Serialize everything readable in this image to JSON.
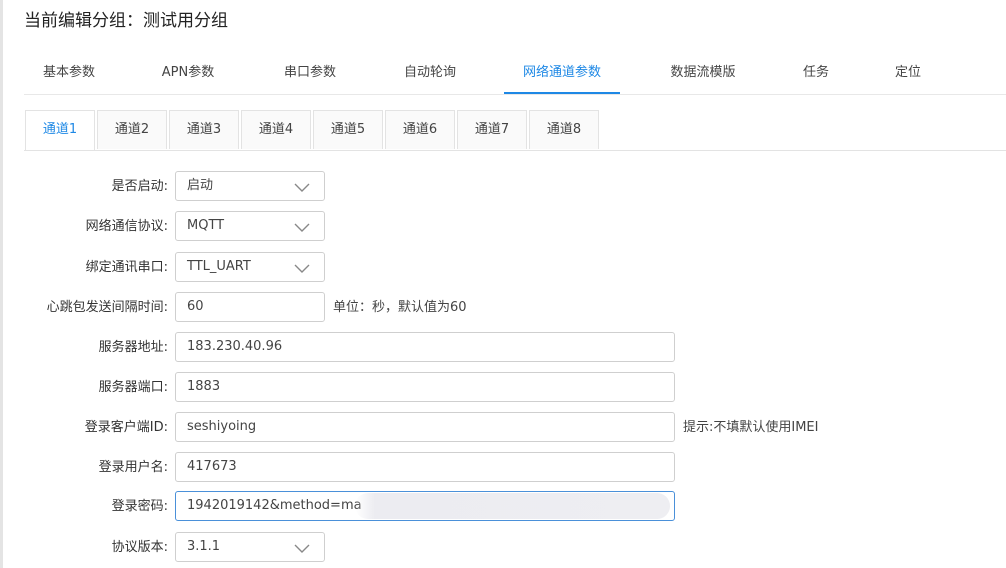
{
  "page": {
    "title": "当前编辑分组：测试用分组"
  },
  "main_tabs": [
    {
      "label": "基本参数"
    },
    {
      "label": "APN参数"
    },
    {
      "label": "串口参数"
    },
    {
      "label": "自动轮询"
    },
    {
      "label": "网络通道参数",
      "active": true
    },
    {
      "label": "数据流模版"
    },
    {
      "label": "任务"
    },
    {
      "label": "定位"
    }
  ],
  "sub_tabs": [
    {
      "label": "通道1",
      "active": true
    },
    {
      "label": "通道2"
    },
    {
      "label": "通道3"
    },
    {
      "label": "通道4"
    },
    {
      "label": "通道5"
    },
    {
      "label": "通道6"
    },
    {
      "label": "通道7"
    },
    {
      "label": "通道8"
    }
  ],
  "form": {
    "enabled": {
      "label": "是否启动:",
      "value": "启动"
    },
    "protocol": {
      "label": "网络通信协议:",
      "value": "MQTT"
    },
    "serial": {
      "label": "绑定通讯串口:",
      "value": "TTL_UART"
    },
    "heartbeat": {
      "label": "心跳包发送间隔时间:",
      "value": "60",
      "hint": "单位：秒，默认值为60"
    },
    "server_address": {
      "label": "服务器地址:",
      "value": "183.230.40.96"
    },
    "server_port": {
      "label": "服务器端口:",
      "value": "1883"
    },
    "client_id": {
      "label": "登录客户端ID:",
      "value": "seshiyoing",
      "hint": "提示:不填默认使用IMEI"
    },
    "username": {
      "label": "登录用户名:",
      "value": "417673"
    },
    "password": {
      "label": "登录密码:",
      "value": "1942019142&method=ma"
    },
    "version": {
      "label": "协议版本:",
      "value": "3.1.1"
    }
  },
  "colors": {
    "accent": "#1e88e5",
    "border": "#cfcfcf",
    "focus_border": "#4a90d9"
  },
  "icons": {
    "select_arrow": "chevron-down-icon"
  }
}
